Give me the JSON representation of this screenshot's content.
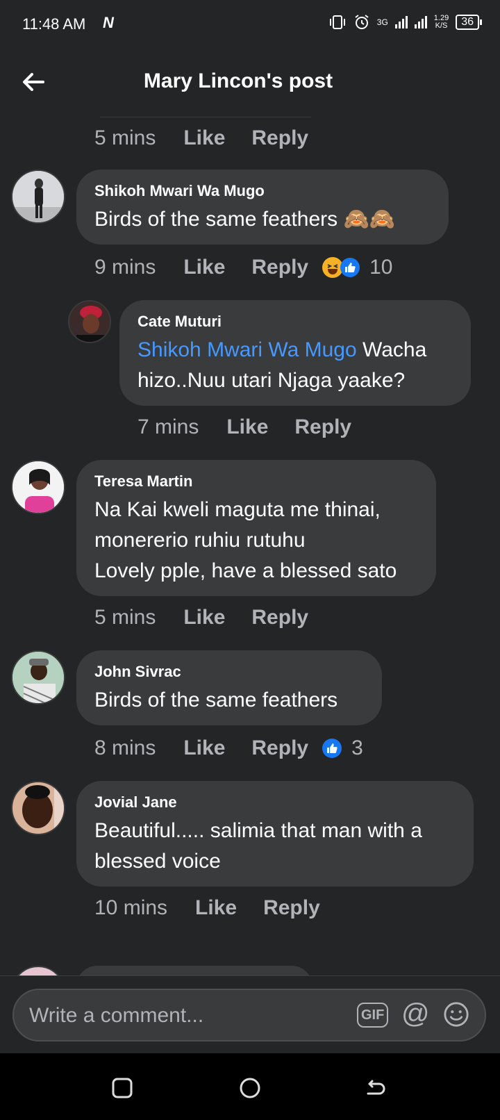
{
  "status": {
    "time": "11:48 AM",
    "carrier_logo": "N",
    "network": "3G",
    "speed_value": "1.29",
    "speed_unit": "K/S",
    "battery": "36"
  },
  "header": {
    "title": "Mary Lincon's post",
    "back_icon": "arrow-left-icon"
  },
  "actions": {
    "like": "Like",
    "reply": "Reply"
  },
  "top_meta": {
    "time": "5 mins"
  },
  "comments": [
    {
      "name": "Shikoh Mwari Wa Mugo",
      "text": "Birds of the same feathers",
      "time": "9 mins",
      "reactions": [
        "haha",
        "like"
      ],
      "count": "10"
    },
    {
      "name": "Cate Muturi",
      "mention": "Shikoh Mwari Wa Mugo",
      "text": " Wacha hizo..Nuu utari Njaga yaake?",
      "time": "7 mins"
    },
    {
      "name": "Teresa Martin",
      "text": "Na Kai kweli maguta me thinai,\nmonererio ruhiu rutuhu\nLovely pple, have a blessed sato",
      "time": "5 mins"
    },
    {
      "name": "John Sivrac",
      "text": "Birds of the same feathers",
      "time": "8 mins",
      "reactions": [
        "like"
      ],
      "count": "3"
    },
    {
      "name": "Jovial Jane",
      "text": "Beautiful..... salimia that man with a blessed voice",
      "time": "10 mins"
    }
  ],
  "composer": {
    "placeholder": "Write a comment...",
    "gif_label": "GIF",
    "at_symbol": "@"
  },
  "colors": {
    "background": "#242526",
    "bubble": "#3a3b3c",
    "mention": "#4599ff",
    "like_blue": "#1877f2",
    "haha_yellow": "#f7b125"
  }
}
